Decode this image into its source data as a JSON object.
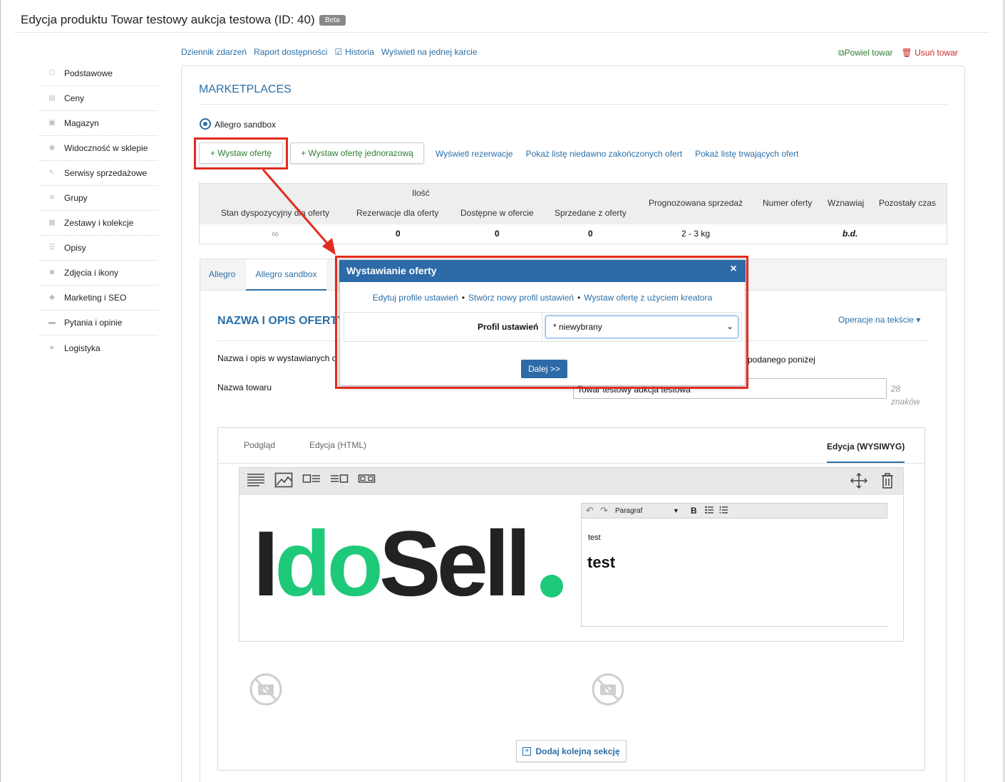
{
  "header": {
    "title": "Edycja produktu Towar testowy aukcja testowa (ID: 40)",
    "badge": "Beta"
  },
  "sidebar": {
    "items": [
      {
        "label": "Podstawowe",
        "icon": "cube-icon"
      },
      {
        "label": "Ceny",
        "icon": "price-icon"
      },
      {
        "label": "Magazyn",
        "icon": "warehouse-icon"
      },
      {
        "label": "Widoczność w sklepie",
        "icon": "eye-icon"
      },
      {
        "label": "Serwisy sprzedażowe",
        "icon": "hammer-icon"
      },
      {
        "label": "Grupy",
        "icon": "layers-icon"
      },
      {
        "label": "Zestawy i kolekcje",
        "icon": "stack-icon"
      },
      {
        "label": "Opisy",
        "icon": "lines-icon"
      },
      {
        "label": "Zdjęcia i ikony",
        "icon": "camera-icon"
      },
      {
        "label": "Marketing i SEO",
        "icon": "tag-icon"
      },
      {
        "label": "Pytania i opinie",
        "icon": "chat-icon"
      },
      {
        "label": "Logistyka",
        "icon": "send-icon"
      }
    ]
  },
  "top_links": {
    "event_log": "Dziennik zdarzeń",
    "availability_report": "Raport dostępności",
    "history": "Historia",
    "single_card": "Wyświetl na jednej karcie",
    "copy": "Powiel towar",
    "delete": "Usuń towar"
  },
  "marketplaces": {
    "title": "MARKETPLACES",
    "radio_label": "Allegro sandbox",
    "btn_post": "+ Wystaw ofertę",
    "btn_post_once": "+ Wystaw ofertę jednorazową",
    "links": [
      "Wyświetl rezerwacje",
      "Pokaż listę niedawno zakończonych ofert",
      "Pokaż listę trwających ofert"
    ]
  },
  "stats_table": {
    "group_header": "Ilość",
    "headers": [
      "Stan dyspozycyjny dla oferty",
      "Rezerwacje dla oferty",
      "Dostępne w ofercie",
      "Sprzedane z oferty",
      "Prognozowana sprzedaż",
      "Numer oferty",
      "Wznawiaj",
      "Pozostały czas"
    ],
    "row": [
      "∞",
      "0",
      "0",
      "0",
      "2 - 3 kg",
      "",
      "b.d.",
      ""
    ]
  },
  "tabs": {
    "allegro": "Allegro",
    "sandbox": "Allegro sandbox"
  },
  "section": {
    "title": "NAZWA I OPIS OFERTY",
    "ops": "Operacje na tekście",
    "desc_left": "Nazwa i opis w wystawianych o",
    "desc_right": "podanego poniżej",
    "name_label": "Nazwa towaru",
    "name_value": "Towar testowy aukcja testowa",
    "char_count": "28",
    "char_unit": "znaków"
  },
  "editor": {
    "tab_preview": "Podgląd",
    "tab_html": "Edycja (HTML)",
    "tab_wysiwyg": "Edycja (WYSIWYG)",
    "format": "Paragraf",
    "bold": "B",
    "paragraph_text": "test",
    "heading_text": "test",
    "add_section": "Dodaj kolejną sekcję"
  },
  "logo": {
    "part_dark_1": "I",
    "part_green": "do",
    "part_dark_2": "Sell",
    "dark_color": "#222222",
    "green_color": "#1fc97a"
  },
  "modal": {
    "title": "Wystawianie oferty",
    "close": "×",
    "link_edit": "Edytuj profile ustawień",
    "link_new": "Stwórz nowy profil ustawień",
    "link_wizard": "Wystaw ofertę z użyciem kreatora",
    "separator": "•",
    "profile_label": "Profil ustawień",
    "profile_value": "* niewybrany",
    "next": "Dalej >>"
  },
  "colors": {
    "accent": "#2a6fa8",
    "modal_header": "#2d6aa8",
    "highlight_red": "#e32b1e",
    "green": "#2e7d32"
  }
}
